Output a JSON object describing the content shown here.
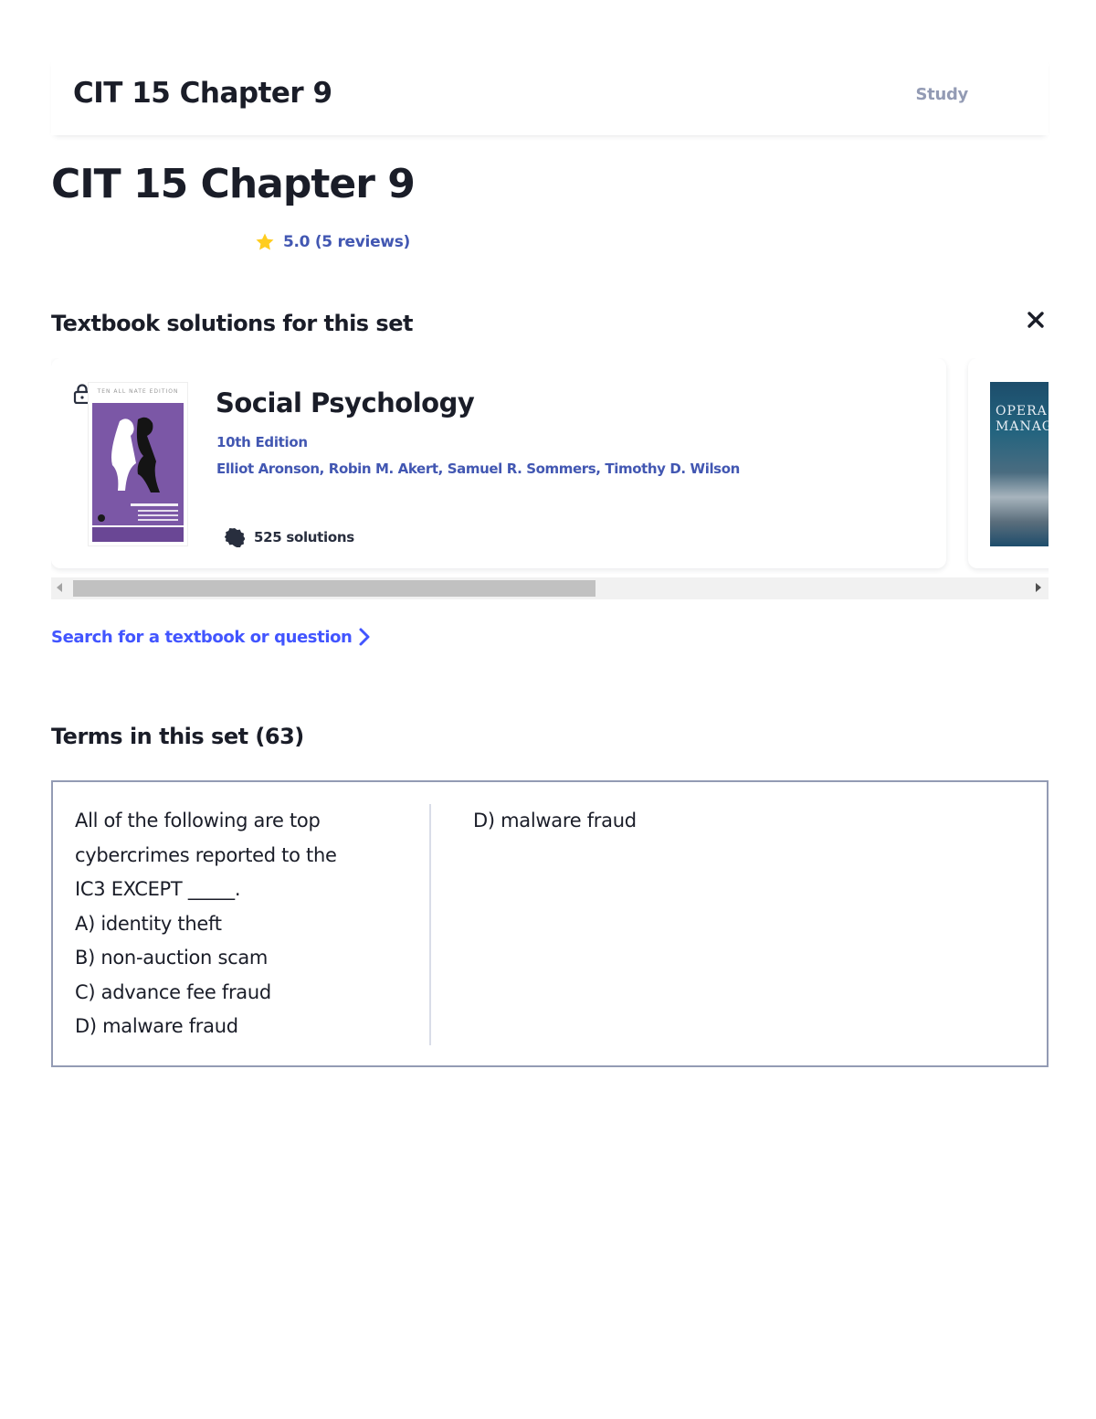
{
  "header": {
    "title": "CIT 15 Chapter 9",
    "study_label": "Study"
  },
  "page": {
    "title": "CIT 15 Chapter 9",
    "rating_text": "5.0 (5 reviews)"
  },
  "textbooks": {
    "section_title": "Textbook solutions for this set",
    "books": [
      {
        "title": "Social Psychology",
        "edition": "10th Edition",
        "authors": "Elliot Aronson, Robin M. Akert, Samuel R. Sommers, Timothy D. Wilson",
        "solutions": "525 solutions",
        "cover_top_text": "TEN ALL NATE EDITION"
      },
      {
        "cover_text": "OPERA\nMANAG"
      }
    ],
    "search_link": "Search for a textbook or question"
  },
  "terms": {
    "section_title": "Terms in this set (63)",
    "items": [
      {
        "term": "All of the following are top\ncybercrimes reported to the\nIC3 EXCEPT _____.\nA) identity theft\nB) non-auction scam\nC) advance fee fraud\nD) malware fraud",
        "definition": "D) malware fraud"
      }
    ]
  },
  "colors": {
    "accent": "#4255ff",
    "muted": "#939bb4",
    "star": "#ffcd1f",
    "text": "#1a1d28"
  }
}
